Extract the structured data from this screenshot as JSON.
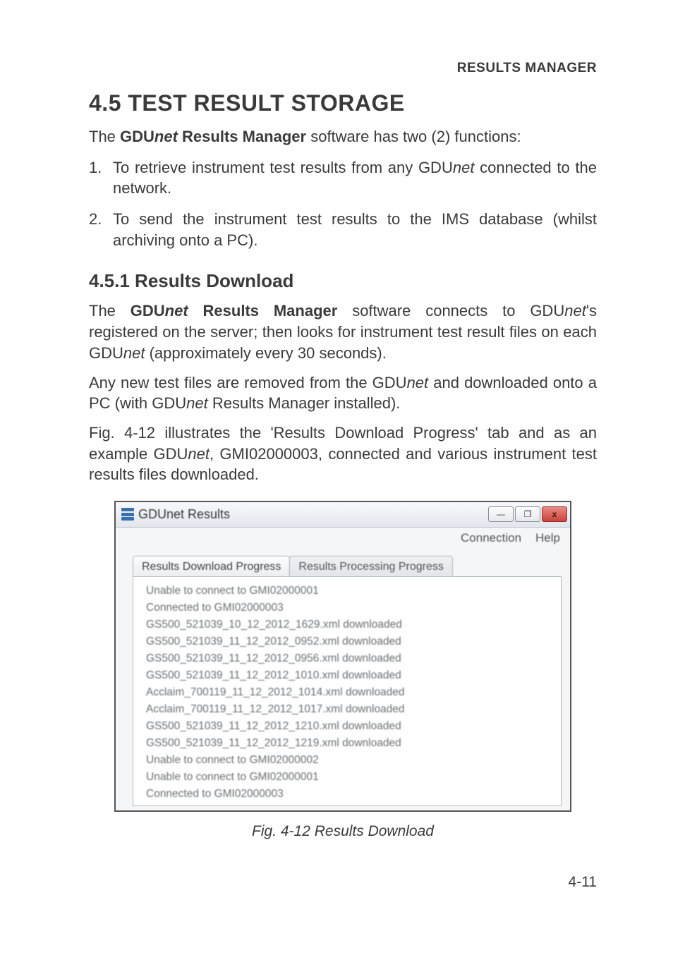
{
  "header": {
    "section": "RESULTS MANAGER"
  },
  "title": "4.5  TEST RESULT STORAGE",
  "intro": {
    "pre": "The ",
    "b1": "GDU",
    "i1": "net",
    "b2": " Results Manager",
    "post": " software has two (2) functions:"
  },
  "functions": [
    {
      "num": "1.",
      "pre": "To retrieve instrument test results from any GDU",
      "i": "net",
      "post": " connected to the network."
    },
    {
      "num": "2.",
      "pre": "To send the instrument test results to the IMS database (whilst archiving onto a PC).",
      "i": "",
      "post": ""
    }
  ],
  "subheading": "4.5.1  Results Download",
  "para1": {
    "t1": "The ",
    "b1": "GDU",
    "i1": "net",
    "b2": " Results Manager",
    "t2": " software connects to GDU",
    "i2": "net",
    "t3": "'s registered on the server; then looks for instrument test result  files on each GDU",
    "i3": "net",
    "t4": " (approximately every 30 seconds)."
  },
  "para2": {
    "t1": "Any new test files are removed from the GDU",
    "i1": "net",
    "t2": " and downloaded onto a PC (with GDU",
    "i2": "net",
    "t3": " Results Manager installed)."
  },
  "para3": {
    "t1": "Fig. 4-12 illustrates the 'Results Download Progress' tab and as an example GDU",
    "i1": "net",
    "t2": ", GMI02000003, connected and various instrument test results files downloaded."
  },
  "window": {
    "title": "GDUnet Results",
    "menu": {
      "connection": "Connection",
      "help": "Help"
    },
    "tabs": {
      "active": "Results Download Progress",
      "inactive": "Results Processing Progress"
    },
    "log": [
      "Unable to connect to GMI02000001",
      "Connected to GMI02000003",
      "GS500_521039_10_12_2012_1629.xml downloaded",
      "GS500_521039_11_12_2012_0952.xml downloaded",
      "GS500_521039_11_12_2012_0956.xml downloaded",
      "GS500_521039_11_12_2012_1010.xml downloaded",
      "Acclaim_700119_11_12_2012_1014.xml downloaded",
      "Acclaim_700119_11_12_2012_1017.xml downloaded",
      "GS500_521039_11_12_2012_1210.xml downloaded",
      "GS500_521039_11_12_2012_1219.xml downloaded",
      "Unable to connect to GMI02000002",
      "Unable to connect to GMI02000001",
      "Connected to GMI02000003"
    ],
    "buttons": {
      "min": "—",
      "max": "❐",
      "close": "x"
    }
  },
  "caption": "Fig. 4-12  Results Download",
  "pagenum": "4-11"
}
